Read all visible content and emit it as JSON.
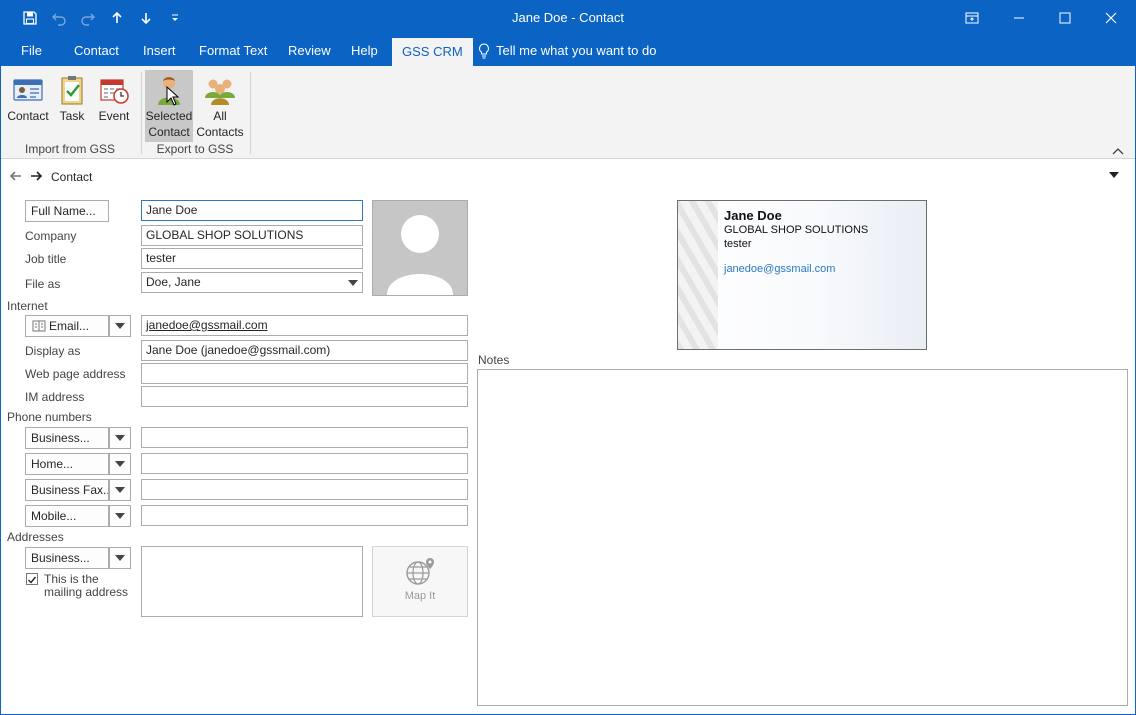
{
  "window": {
    "title": "Jane Doe  -  Contact"
  },
  "tabs": [
    {
      "label": "File"
    },
    {
      "label": "Contact"
    },
    {
      "label": "Insert"
    },
    {
      "label": "Format Text"
    },
    {
      "label": "Review"
    },
    {
      "label": "Help"
    },
    {
      "label": "GSS CRM"
    }
  ],
  "tell_me": "Tell me what you want to do",
  "ribbon": {
    "import_group": {
      "label": "Import from GSS",
      "buttons": [
        {
          "label": "Contact",
          "icon": "contact-card-icon"
        },
        {
          "label": "Task",
          "icon": "task-clipboard-icon"
        },
        {
          "label": "Event",
          "icon": "event-calendar-icon"
        }
      ]
    },
    "export_group": {
      "label": "Export to GSS",
      "buttons": [
        {
          "line1": "Selected",
          "line2": "Contact",
          "icon": "selected-contact-icon"
        },
        {
          "line1": "All",
          "line2": "Contacts",
          "icon": "all-contacts-icon"
        }
      ]
    }
  },
  "nav": {
    "label": "Contact"
  },
  "form": {
    "full_name_button": "Full Name...",
    "full_name": "Jane Doe",
    "company_label": "Company",
    "company": "GLOBAL SHOP SOLUTIONS",
    "job_title_label": "Job title",
    "job_title": "tester",
    "file_as_label": "File as",
    "file_as": "Doe, Jane",
    "internet_label": "Internet",
    "email_button": "Email...",
    "email": "janedoe@gssmail.com",
    "display_as_label": "Display as",
    "display_as": "Jane Doe (janedoe@gssmail.com)",
    "web_page_label": "Web page address",
    "web_page": "",
    "im_label": "IM address",
    "im": "",
    "phone_label": "Phone numbers",
    "phones": [
      {
        "type": "Business...",
        "value": ""
      },
      {
        "type": "Home...",
        "value": ""
      },
      {
        "type": "Business Fax...",
        "value": ""
      },
      {
        "type": "Mobile...",
        "value": ""
      }
    ],
    "addresses_label": "Addresses",
    "address_type": "Business...",
    "address": "",
    "mailing_line1": "This is the",
    "mailing_line2": "mailing address",
    "mailing_checked": true,
    "map_it": "Map It",
    "notes_label": "Notes"
  },
  "card": {
    "name": "Jane Doe",
    "company": "GLOBAL SHOP SOLUTIONS",
    "title": "tester",
    "email": "janedoe@gssmail.com"
  },
  "colors": {
    "accent": "#0b63c4",
    "link": "#2b78c8"
  }
}
